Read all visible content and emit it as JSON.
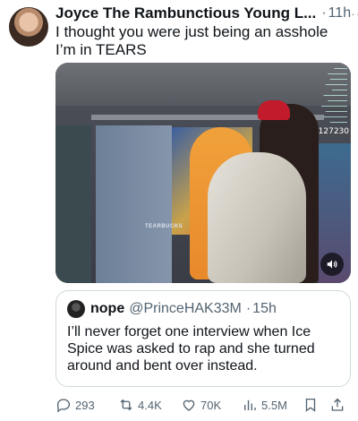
{
  "tweet": {
    "author": "Joyce The Rambunctious Young L...",
    "time_sep": "·",
    "time": "11h",
    "more": "···",
    "text": "I thought you were just being an asshole I’m in TEARS"
  },
  "media": {
    "viewer_count": "127230",
    "watermark": "TEARBUCKS"
  },
  "quote": {
    "name": "nope",
    "handle": "@PrinceHAK33M",
    "time_sep": "·",
    "time": "15h",
    "text": "I’ll never forget one interview when Ice Spice was asked to rap and she turned around and bent over instead."
  },
  "actions": {
    "replies": "293",
    "retweets": "4.4K",
    "likes": "70K",
    "views": "5.5M"
  },
  "colors": {
    "verified": "#1d9bf0",
    "secondary_text": "#536471",
    "border": "#cfd9de"
  }
}
